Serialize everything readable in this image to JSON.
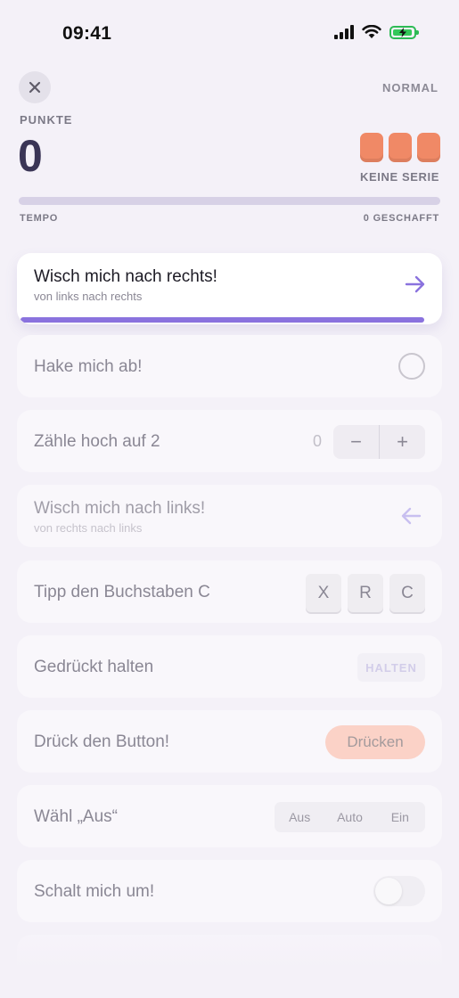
{
  "status": {
    "time": "09:41"
  },
  "header": {
    "difficulty": "NORMAL",
    "score_label": "PUNKTE",
    "score": "0",
    "streak_label": "KEINE SERIE",
    "tempo_label": "TEMPO",
    "done_label": "0 GESCHAFFT",
    "lives": 3,
    "tempo_progress": 0
  },
  "tasks": {
    "swipe_right": {
      "title": "Wisch mich nach rechts!",
      "subtitle": "von links nach rechts"
    },
    "check": {
      "title": "Hake mich ab!"
    },
    "count": {
      "title": "Zähle hoch auf 2",
      "value": "0",
      "minus": "−",
      "plus": "+"
    },
    "swipe_left": {
      "title": "Wisch mich nach links!",
      "subtitle": "von rechts nach links"
    },
    "letters": {
      "title": "Tipp den Buchstaben C",
      "keys": [
        "X",
        "R",
        "C"
      ]
    },
    "hold": {
      "title": "Gedrückt halten",
      "button": "HALTEN"
    },
    "press": {
      "title": "Drück den Button!",
      "button": "Drücken"
    },
    "choose": {
      "title": "Wähl „Aus“",
      "options": [
        "Aus",
        "Auto",
        "Ein"
      ]
    },
    "toggle": {
      "title": "Schalt mich um!",
      "state": "off"
    }
  },
  "colors": {
    "accent": "#8a72de",
    "heart": "#f08966",
    "press_button": "#fbd2c7",
    "battery": "#34c759"
  }
}
